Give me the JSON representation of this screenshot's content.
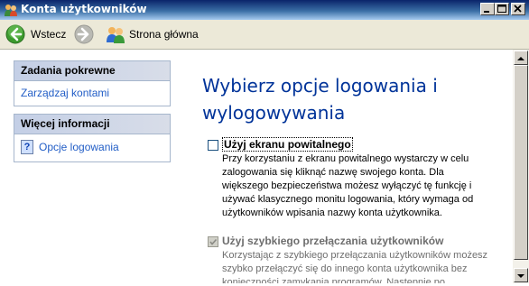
{
  "window": {
    "title": "Konta użytkowników",
    "icon": "users-icon",
    "controls": [
      "minimize",
      "maximize",
      "close"
    ]
  },
  "toolbar": {
    "back_label": "Wstecz",
    "home_label": "Strona główna"
  },
  "sidebar": {
    "boxes": [
      {
        "header": "Zadania pokrewne",
        "items": [
          {
            "label": "Zarządzaj kontami"
          }
        ]
      },
      {
        "header": "Więcej informacji",
        "items": [
          {
            "label": "Opcje logowania",
            "icon": "help-icon"
          }
        ]
      }
    ]
  },
  "main": {
    "heading": "Wybierz opcje logowania i wylogowywania",
    "options": [
      {
        "label": "Użyj ekranu powitalnego",
        "checked": false,
        "enabled": true,
        "description": "Przy korzystaniu z ekranu powitalnego wystarczy w celu zalogowania się kliknąć nazwę swojego konta. Dla większego bezpieczeństwa możesz wyłączyć tę funkcję i używać klasycznego monitu logowania, który wymaga od użytkowników wpisania nazwy konta użytkownika."
      },
      {
        "label": "Użyj szybkiego przełączania użytkowników",
        "checked": true,
        "enabled": false,
        "description": "Korzystając z szybkiego przełączania użytkowników możesz szybko przełączyć się do innego konta użytkownika bez konieczności zamykania programów. Następnie po"
      }
    ]
  },
  "colors": {
    "heading": "#003399",
    "link": "#215dc6",
    "titlebar": "#0a246a"
  }
}
